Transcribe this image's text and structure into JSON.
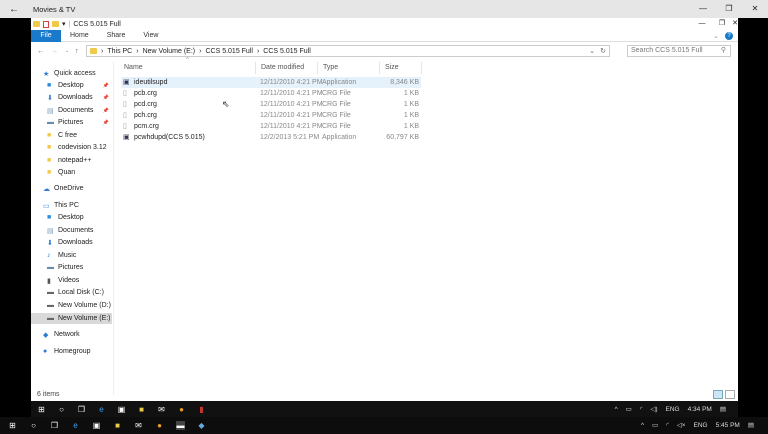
{
  "app": {
    "title": "Movies & TV"
  },
  "explorer": {
    "title": "CCS 5.015 Full",
    "ribbon_tabs": [
      "File",
      "Home",
      "Share",
      "View"
    ],
    "breadcrumb": [
      "This PC",
      "New Volume (E:)",
      "CCS 5.015 Full",
      "CCS 5.015 Full"
    ],
    "search_placeholder": "Search CCS 5.015 Full",
    "sidebar": [
      {
        "label": "Quick access",
        "icon": "star-icon",
        "pinned": false
      },
      {
        "label": "Desktop",
        "icon": "desktop-icon",
        "pinned": true
      },
      {
        "label": "Downloads",
        "icon": "download-icon",
        "pinned": true
      },
      {
        "label": "Documents",
        "icon": "documents-icon",
        "pinned": true
      },
      {
        "label": "Pictures",
        "icon": "pictures-icon",
        "pinned": true
      },
      {
        "label": "C free",
        "icon": "folder-icon",
        "pinned": false
      },
      {
        "label": "codevision 3.12",
        "icon": "folder-icon",
        "pinned": false
      },
      {
        "label": "notepad++",
        "icon": "folder-icon",
        "pinned": false
      },
      {
        "label": "Quan",
        "icon": "folder-icon",
        "pinned": false
      },
      {
        "label": "OneDrive",
        "icon": "cloud-icon",
        "pinned": false
      },
      {
        "label": "This PC",
        "icon": "computer-icon",
        "pinned": false
      },
      {
        "label": "Desktop",
        "icon": "desktop-icon",
        "pinned": false
      },
      {
        "label": "Documents",
        "icon": "documents-icon",
        "pinned": false
      },
      {
        "label": "Downloads",
        "icon": "download-icon",
        "pinned": false
      },
      {
        "label": "Music",
        "icon": "music-icon",
        "pinned": false
      },
      {
        "label": "Pictures",
        "icon": "pictures-icon",
        "pinned": false
      },
      {
        "label": "Videos",
        "icon": "videos-icon",
        "pinned": false
      },
      {
        "label": "Local Disk (C:)",
        "icon": "drive-icon",
        "pinned": false
      },
      {
        "label": "New Volume (D:)",
        "icon": "drive-icon",
        "pinned": false
      },
      {
        "label": "New Volume (E:)",
        "icon": "drive-icon",
        "pinned": false
      },
      {
        "label": "Network",
        "icon": "network-icon",
        "pinned": false
      },
      {
        "label": "Homegroup",
        "icon": "homegroup-icon",
        "pinned": false
      }
    ],
    "columns": [
      "Name",
      "Date modified",
      "Type",
      "Size"
    ],
    "files": [
      {
        "name": "ideutilsupd",
        "date": "12/11/2010 4:21 PM",
        "type": "Application",
        "size": "8,346 KB"
      },
      {
        "name": "pcb.crg",
        "date": "12/11/2010 4:21 PM",
        "type": "CRG File",
        "size": "1 KB"
      },
      {
        "name": "pcd.crg",
        "date": "12/11/2010 4:21 PM",
        "type": "CRG File",
        "size": "1 KB"
      },
      {
        "name": "pch.crg",
        "date": "12/11/2010 4:21 PM",
        "type": "CRG File",
        "size": "1 KB"
      },
      {
        "name": "pcm.crg",
        "date": "12/11/2010 4:21 PM",
        "type": "CRG File",
        "size": "1 KB"
      },
      {
        "name": "pcwhdupd(CCS 5.015)",
        "date": "12/2/2013 5:21 PM",
        "type": "Application",
        "size": "60,797 KB"
      }
    ],
    "status": "6 items"
  },
  "taskbar_inner": {
    "lang": "ENG",
    "time": "4:34 PM"
  },
  "taskbar_outer": {
    "lang": "ENG",
    "time": "5:45 PM"
  },
  "colors": {
    "accent": "#1979ca",
    "selection": "#e5f1fb"
  }
}
